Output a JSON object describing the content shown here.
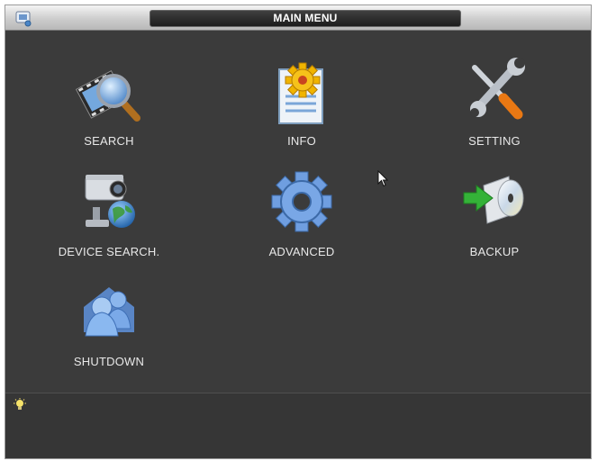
{
  "window": {
    "title": "MAIN MENU"
  },
  "menu": {
    "items": [
      {
        "id": "search",
        "label": "SEARCH",
        "icon": "film-magnifier-icon"
      },
      {
        "id": "info",
        "label": "INFO",
        "icon": "document-gear-icon"
      },
      {
        "id": "setting",
        "label": "SETTING",
        "icon": "wrench-screwdriver-icon"
      },
      {
        "id": "device-search",
        "label": "DEVICE SEARCH.",
        "icon": "camera-globe-icon"
      },
      {
        "id": "advanced",
        "label": "ADVANCED",
        "icon": "gear-icon"
      },
      {
        "id": "backup",
        "label": "BACKUP",
        "icon": "disc-arrow-icon"
      },
      {
        "id": "shutdown",
        "label": "SHUTDOWN",
        "icon": "users-icon"
      }
    ]
  },
  "status": {
    "tip_icon": "lightbulb-icon"
  },
  "colors": {
    "background": "#3b3b3b",
    "titlebar": "#cdcdcd",
    "label": "#e8e8e8",
    "accent_blue": "#4f87d6"
  }
}
